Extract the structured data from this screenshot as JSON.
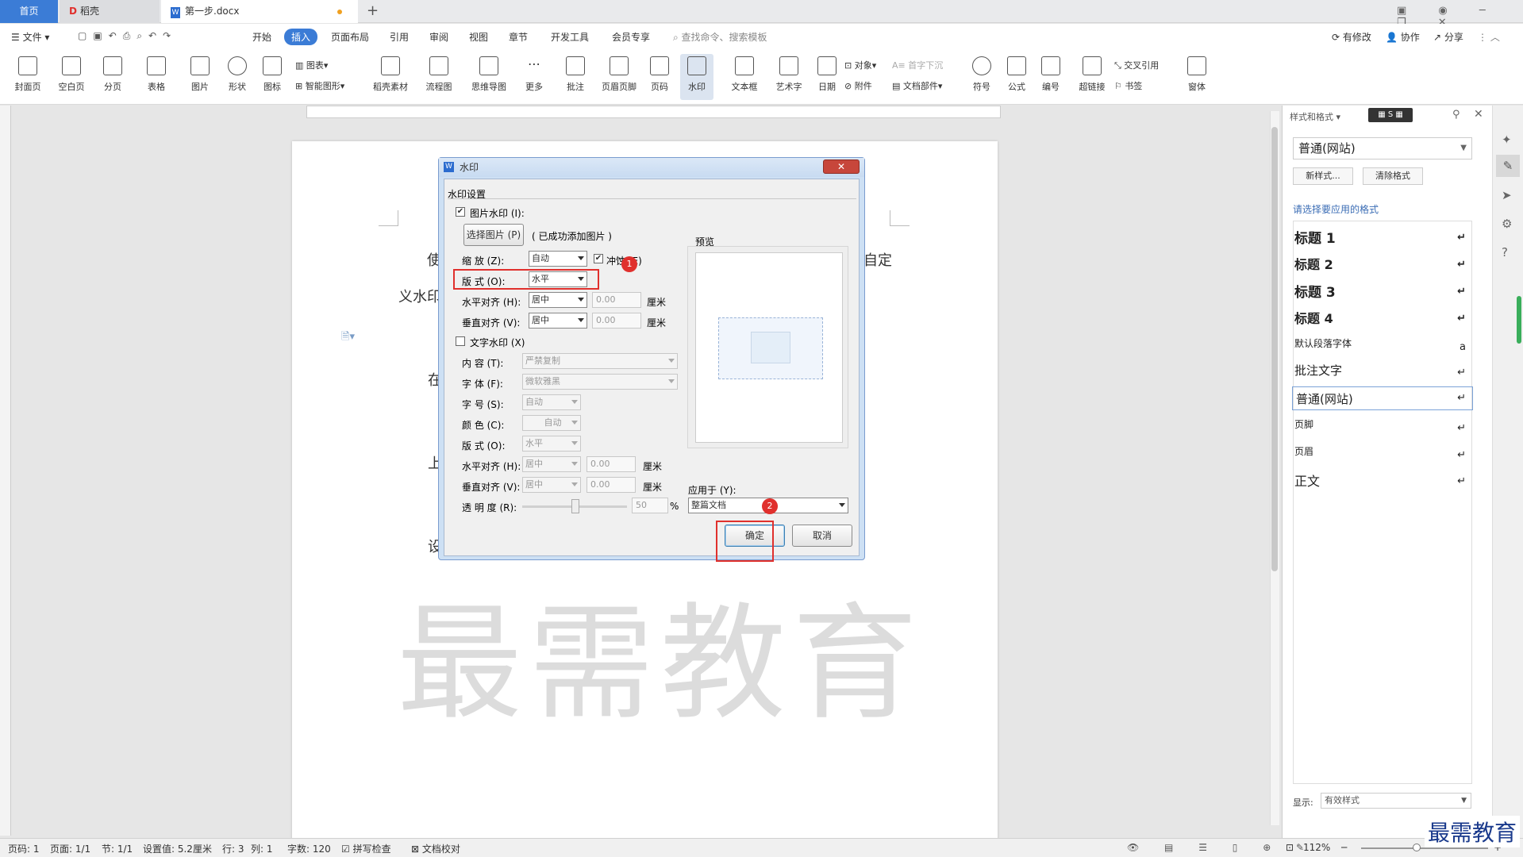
{
  "tabs": {
    "home": "首页",
    "t2": "稻壳",
    "t3": "第一步.docx"
  },
  "menu": {
    "file": "文件",
    "items": [
      "开始",
      "插入",
      "页面布局",
      "引用",
      "审阅",
      "视图",
      "章节",
      "开发工具",
      "会员专享"
    ],
    "search": "查找命令、搜索模板",
    "right": [
      "有修改",
      "协作",
      "分享"
    ]
  },
  "ribbon": {
    "big": [
      "封面页",
      "空白页",
      "分页",
      "表格",
      "图片",
      "形状",
      "图标",
      "稻壳素材",
      "流程图",
      "思维导图",
      "更多",
      "批注",
      "页眉页脚",
      "页码",
      "水印",
      "文本框",
      "艺术字",
      "日期",
      "符号",
      "公式",
      "编号",
      "超链接",
      "窗体"
    ],
    "small": [
      "图表",
      "智能图形",
      "对象",
      "附件",
      "首字下沉",
      "文档部件",
      "交叉引用",
      "书签"
    ]
  },
  "document": {
    "l1a": "使",
    "l1b": "自定",
    "l2": "义水印",
    "l3": "在",
    "l4": "上",
    "l5": "设",
    "watermark": "最需教育"
  },
  "dialog": {
    "title": "水印",
    "section": "水印设置",
    "pic_watermark": "图片水印 (I):",
    "choose_pic": "选择图片 (P)",
    "added": "( 已成功添加图片 )",
    "scale_label": "缩  放 (Z):",
    "scale_value": "自动",
    "washout": "冲蚀 (E)",
    "layout_label": "版  式 (O):",
    "layout_value": "水平",
    "halign_label": "水平对齐 (H):",
    "halign_value": "居中",
    "hoffset": "0.00",
    "valign_label": "垂直对齐 (V):",
    "valign_value": "居中",
    "voffset": "0.00",
    "unit": "厘米",
    "text_watermark": "文字水印 (X)",
    "content_label": "内  容 (T):",
    "content_value": "严禁复制",
    "font_label": "字  体 (F):",
    "font_value": "微软雅黑",
    "size_label": "字  号 (S):",
    "size_value": "自动",
    "color_label": "颜  色 (C):",
    "color_value": "自动",
    "tlayout_label": "版  式 (O):",
    "tlayout_value": "水平",
    "thalign_label": "水平对齐 (H):",
    "thalign_value": "居中",
    "thoffset": "0.00",
    "tvalign_label": "垂直对齐 (V):",
    "tvalign_value": "居中",
    "tvoffset": "0.00",
    "transparency_label": "透 明 度 (R):",
    "transparency_value": "50",
    "percent": "%",
    "preview": "预览",
    "apply_label": "应用于 (Y):",
    "apply_value": "整篇文档",
    "ok": "确定",
    "cancel": "取消",
    "badge1": "1",
    "badge2": "2"
  },
  "side": {
    "title": "样式和格式",
    "current": "普通(网站)",
    "new_style": "新样式...",
    "clear": "清除格式",
    "hint": "请选择要应用的格式",
    "styles": [
      "标题 1",
      "标题 2",
      "标题 3",
      "标题 4",
      "默认段落字体",
      "批注文字",
      "普通(网站)",
      "页脚",
      "页眉",
      "正文"
    ],
    "show_label": "显示:",
    "show_value": "有效样式"
  },
  "status": {
    "page": "页码: 1",
    "pages": "页面: 1/1",
    "section": "节: 1/1",
    "setting": "设置值: 5.2厘米",
    "row": "行: 3",
    "col": "列: 1",
    "words": "字数: 120",
    "spell": "拼写检查",
    "proof": "文档校对",
    "zoom": "112%"
  },
  "logo": "最需教育"
}
